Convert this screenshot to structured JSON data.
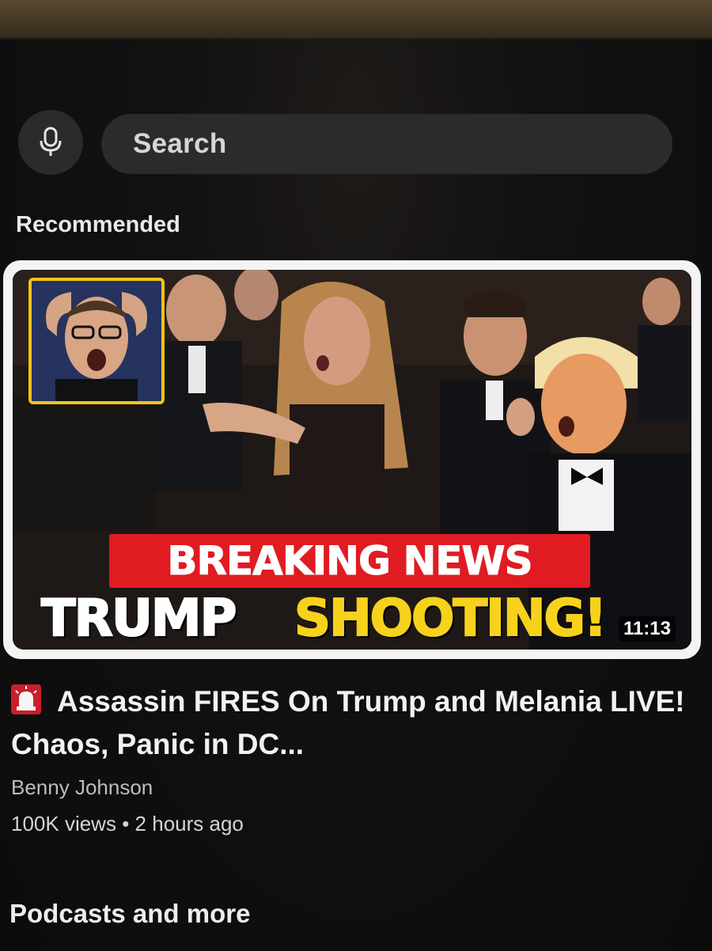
{
  "search": {
    "mic_icon": "microphone-icon",
    "placeholder": "Search"
  },
  "sections": {
    "recommended": "Recommended",
    "podcasts": "Podcasts and more"
  },
  "video": {
    "thumbnail": {
      "headline_line1": "BREAKING NEWS",
      "headline_word1": "TRUMP",
      "headline_word2": "SHOOTING!",
      "duration": "11:13",
      "colors": {
        "red_banner": "#e01b22",
        "yellow_text": "#f7d21c",
        "inset_border": "#f0c419"
      }
    },
    "alert_icon": "siren-emoji-icon",
    "title": "Assassin FIRES On Trump and Melania LIVE! Chaos, Panic in DC...",
    "channel": "Benny Johnson",
    "views": "100K views",
    "separator": "•",
    "age": "2 hours ago"
  }
}
